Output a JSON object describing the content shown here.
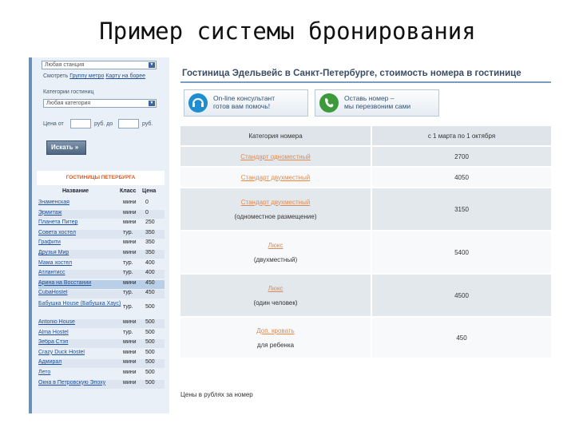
{
  "slide_title": "Пример системы бронирования",
  "sidebar": {
    "station_select": "Любая станция",
    "view_label": "Смотреть",
    "view_list_link": "Группу метро",
    "view_map_link": "Карту на борее",
    "category_label": "Категории гостиниц",
    "category_select": "Любая категория",
    "price_from_label": "Цена от",
    "price_mid_label": "руб. до",
    "price_to_label": "руб.",
    "search_button": "Искать »",
    "hotels_header": "ГОСТИНИЦЫ ПЕТЕРБУРГА",
    "col_name": "Название",
    "col_class": "Класс",
    "col_price": "Цена",
    "hotels": [
      {
        "name": "Знаменская",
        "cls": "мини",
        "price": "0"
      },
      {
        "name": "Эрмитаж",
        "cls": "мини",
        "price": "0"
      },
      {
        "name": "Планета Питер",
        "cls": "мини",
        "price": "250"
      },
      {
        "name": "Совета хостел",
        "cls": "тур.",
        "price": "350"
      },
      {
        "name": "Графити",
        "cls": "мини",
        "price": "350"
      },
      {
        "name": "Друзья Мир",
        "cls": "мини",
        "price": "350"
      },
      {
        "name": "Мама хостел",
        "cls": "тур.",
        "price": "400"
      },
      {
        "name": "Атлантисс",
        "cls": "тур.",
        "price": "400"
      },
      {
        "name": "Арина на Восстании",
        "cls": "мини",
        "price": "450"
      },
      {
        "name": "CubaHostel",
        "cls": "тур.",
        "price": "450"
      },
      {
        "name": "Бабушка House (Бабушка Хаус)",
        "cls": "тур.",
        "price": "500"
      },
      {
        "name": "Antonio House",
        "cls": "мини",
        "price": "500"
      },
      {
        "name": "Alma Hostel",
        "cls": "тур.",
        "price": "500"
      },
      {
        "name": "Зебра Стэп",
        "cls": "мини",
        "price": "500"
      },
      {
        "name": "Crazy Duck Hostel",
        "cls": "мини",
        "price": "500"
      },
      {
        "name": "Адмирал",
        "cls": "мини",
        "price": "500"
      },
      {
        "name": "Лето",
        "cls": "мини",
        "price": "500"
      },
      {
        "name": "Окна в Петровскую Эпоху",
        "cls": "мини",
        "price": "500"
      }
    ]
  },
  "main": {
    "title": "Гостиница Эдельвейс в Санкт-Петербурге, стоимость номера в гостинице",
    "online_line1": "On-line консультант",
    "online_line2": "готов вам помочь!",
    "callback_line1": "Оставь номер –",
    "callback_line2": "мы перезвоним сами",
    "col_category": "Категория номера",
    "col_period": "с 1 марта по 1 октября",
    "rooms": [
      {
        "name": "Стандарт одноместный",
        "desc": "",
        "price": "2700"
      },
      {
        "name": "Стандарт двухместный",
        "desc": "",
        "price": "4050"
      },
      {
        "name": "Стандарт двухместный",
        "desc": "(одноместное размещение)",
        "price": "3150"
      },
      {
        "name": "Люкс",
        "desc": "(двухместный)",
        "price": "5400"
      },
      {
        "name": "Люкс",
        "desc": "(один человек)",
        "price": "4500"
      },
      {
        "name": "Доп. кровать",
        "desc": "для ребенка",
        "price": "450"
      }
    ],
    "note": "Цены в рублях за номер"
  },
  "colors": {
    "accent_orange": "#e08a50",
    "link_blue": "#1d4f9c",
    "sidebar_bg": "#e9f0f7"
  }
}
